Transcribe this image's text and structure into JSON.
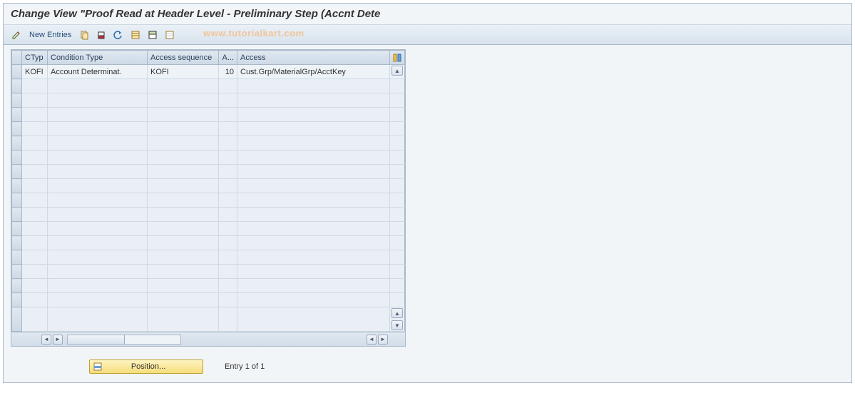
{
  "title": "Change View \"Proof Read at Header Level - Preliminary Step (Accnt Dete",
  "toolbar": {
    "new_entries": "New Entries"
  },
  "watermark": "www.tutorialkart.com",
  "table": {
    "headers": {
      "ctyp": "CTyp",
      "cond_type": "Condition Type",
      "acc_seq": "Access sequence",
      "a": "A...",
      "access": "Access"
    },
    "rows": [
      {
        "ctyp": "KOFI",
        "cond_type": "Account Determinat.",
        "acc_seq": "KOFI",
        "a": "10",
        "access": "Cust.Grp/MaterialGrp/AcctKey"
      }
    ],
    "empty_rows": 17
  },
  "footer": {
    "position": "Position...",
    "entry": "Entry 1 of 1"
  }
}
